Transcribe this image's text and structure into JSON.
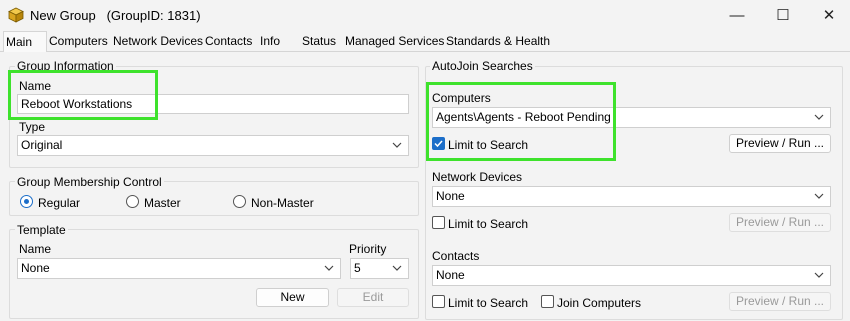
{
  "window": {
    "title": "New Group   (GroupID: 1831)",
    "minimize_glyph": "—",
    "maximize_glyph": "☐",
    "close_glyph": "✕"
  },
  "tabs": [
    {
      "label": "Main"
    },
    {
      "label": "Computers"
    },
    {
      "label": "Network Devices"
    },
    {
      "label": "Contacts"
    },
    {
      "label": "Info"
    },
    {
      "label": "Status"
    },
    {
      "label": "Managed Services"
    },
    {
      "label": "Standards & Health"
    }
  ],
  "group_info": {
    "legend": "Group Information",
    "name_label": "Name",
    "name_value": "Reboot Workstations",
    "type_label": "Type",
    "type_value": "Original"
  },
  "membership": {
    "legend": "Group Membership Control",
    "options": [
      {
        "label": "Regular",
        "selected": true
      },
      {
        "label": "Master",
        "selected": false
      },
      {
        "label": "Non-Master",
        "selected": false
      }
    ]
  },
  "template": {
    "legend": "Template",
    "name_label": "Name",
    "name_value": "None",
    "priority_label": "Priority",
    "priority_value": "5",
    "new_button": "New",
    "edit_button": "Edit"
  },
  "autojoin": {
    "legend": "AutoJoin Searches",
    "computers": {
      "label": "Computers",
      "value": "Agents\\Agents - Reboot Pending",
      "limit_label": "Limit to Search",
      "limit_checked": true,
      "preview_button": "Preview / Run ..."
    },
    "network_devices": {
      "label": "Network Devices",
      "value": "None",
      "limit_label": "Limit to Search",
      "limit_checked": false,
      "preview_button": "Preview / Run ..."
    },
    "contacts": {
      "label": "Contacts",
      "value": "None",
      "limit_label": "Limit to Search",
      "limit_checked": false,
      "join_label": "Join Computers",
      "join_checked": false,
      "preview_button": "Preview / Run ..."
    }
  },
  "colors": {
    "highlight": "#3ee22c",
    "accent": "#1c6ec9"
  }
}
